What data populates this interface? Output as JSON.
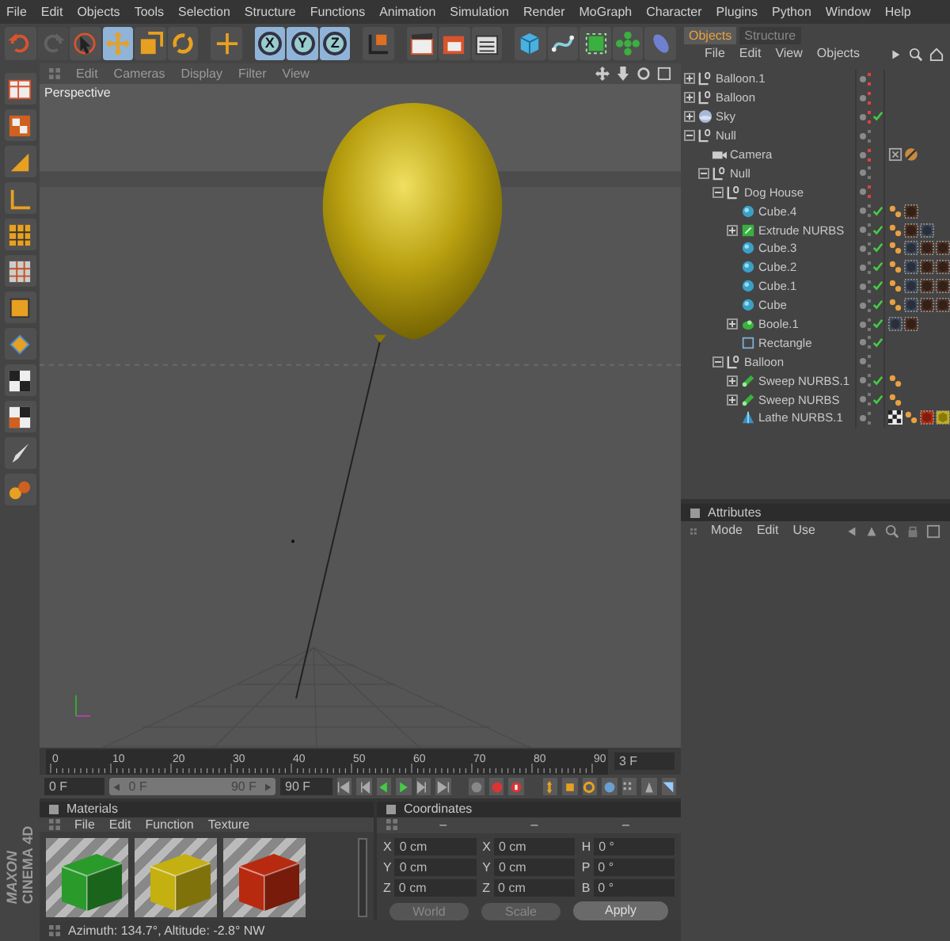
{
  "menu_bar": [
    "File",
    "Edit",
    "Objects",
    "Tools",
    "Selection",
    "Structure",
    "Functions",
    "Animation",
    "Simulation",
    "Render",
    "MoGraph",
    "Character",
    "Plugins",
    "Python",
    "Window",
    "Help"
  ],
  "toolbar": [
    {
      "kind": "undo",
      "selected": false,
      "disabled": false
    },
    {
      "kind": "redo",
      "selected": false,
      "disabled": true
    },
    {
      "kind": "select",
      "selected": false,
      "disabled": false
    },
    {
      "kind": "move",
      "selected": true,
      "disabled": false
    },
    {
      "kind": "scale",
      "selected": false,
      "disabled": false
    },
    {
      "kind": "rotate",
      "selected": false,
      "disabled": false
    },
    {
      "kind": "add",
      "selected": false,
      "disabled": false
    },
    {
      "kind": "axis",
      "label": "X",
      "selected": true,
      "disabled": false
    },
    {
      "kind": "axis",
      "label": "Y",
      "selected": true,
      "disabled": false
    },
    {
      "kind": "axis",
      "label": "Z",
      "selected": true,
      "disabled": false
    },
    {
      "kind": "world",
      "selected": false,
      "disabled": false
    },
    {
      "kind": "render_view",
      "selected": false,
      "disabled": false
    },
    {
      "kind": "render",
      "selected": false,
      "disabled": false
    },
    {
      "kind": "render_settings",
      "selected": false,
      "disabled": false
    },
    {
      "kind": "cube",
      "selected": false,
      "disabled": false
    },
    {
      "kind": "spline",
      "selected": false,
      "disabled": false
    },
    {
      "kind": "nurbs",
      "selected": false,
      "disabled": false
    },
    {
      "kind": "array",
      "selected": false,
      "disabled": false
    },
    {
      "kind": "deformer",
      "selected": false,
      "disabled": false
    }
  ],
  "viewport": {
    "menu": [
      "Edit",
      "Cameras",
      "Display",
      "Filter",
      "View"
    ],
    "label": "Perspective"
  },
  "timeline": {
    "ticks": [
      "0",
      "10",
      "20",
      "30",
      "40",
      "50",
      "60",
      "70",
      "80",
      "90"
    ],
    "current_frame": "3 F",
    "start_frame": "0 F",
    "range_start": "0 F",
    "range_end": "90 F",
    "end_frame": "90 F"
  },
  "materials": {
    "title": "Materials",
    "menu": [
      "File",
      "Edit",
      "Function",
      "Texture"
    ],
    "items": [
      {
        "color": "#2a9a2a"
      },
      {
        "color": "#c4b010"
      },
      {
        "color": "#b82a10"
      }
    ]
  },
  "coordinates": {
    "title": "Coordinates",
    "headers": [
      "–",
      "–",
      "–"
    ],
    "rows": [
      [
        {
          "axis": "X",
          "value": "0 cm"
        },
        {
          "axis": "X",
          "value": "0 cm"
        },
        {
          "axis": "H",
          "value": "0 °"
        }
      ],
      [
        {
          "axis": "Y",
          "value": "0 cm"
        },
        {
          "axis": "Y",
          "value": "0 cm"
        },
        {
          "axis": "P",
          "value": "0 °"
        }
      ],
      [
        {
          "axis": "Z",
          "value": "0 cm"
        },
        {
          "axis": "Z",
          "value": "0 cm"
        },
        {
          "axis": "B",
          "value": "0 °"
        }
      ]
    ],
    "mode": "World",
    "size_mode": "Scale",
    "apply": "Apply"
  },
  "status_bar": "Azimuth: 134.7°, Altitude: -2.8°  NW",
  "logo": {
    "brand": "MAXON",
    "product": "CINEMA 4D"
  },
  "object_manager": {
    "tabs": [
      {
        "label": "Objects",
        "selected": true
      },
      {
        "label": "Structure",
        "selected": false
      }
    ],
    "menu": [
      "File",
      "Edit",
      "View",
      "Objects"
    ],
    "tree": [
      {
        "name": "Balloon.1",
        "kind": "null",
        "expanded": false,
        "hidden": true
      },
      {
        "name": "Balloon",
        "kind": "null",
        "expanded": false,
        "hidden": true
      },
      {
        "name": "Sky",
        "kind": "sky",
        "expanded": false,
        "hidden": true,
        "checked": true
      },
      {
        "name": "Null",
        "kind": "null",
        "expanded": true,
        "hidden": false,
        "children": [
          {
            "name": "Camera",
            "kind": "camera",
            "hidden": true,
            "checked": false,
            "tags": [
              {
                "kind": "display"
              },
              {
                "kind": "protection"
              }
            ]
          },
          {
            "name": "Null",
            "kind": "null",
            "expanded": true,
            "hidden": false,
            "children": [
              {
                "name": "Dog House",
                "kind": "null",
                "expanded": true,
                "hidden": true,
                "children": [
                  {
                    "name": "Cube.4",
                    "kind": "primitive",
                    "hidden": false,
                    "checked": true,
                    "tags": [
                      {
                        "kind": "phong"
                      },
                      {
                        "kind": "texture",
                        "color": "#4a2e20"
                      }
                    ]
                  },
                  {
                    "name": "Extrude NURBS",
                    "kind": "extrude",
                    "expanded": false,
                    "hidden": false,
                    "checked": true,
                    "tags": [
                      {
                        "kind": "phong"
                      },
                      {
                        "kind": "texture",
                        "color": "#4a2e20"
                      },
                      {
                        "kind": "texture",
                        "color": "#3c4656"
                      }
                    ]
                  },
                  {
                    "name": "Cube.3",
                    "kind": "primitive",
                    "hidden": false,
                    "checked": true,
                    "tags": [
                      {
                        "kind": "phong"
                      },
                      {
                        "kind": "texture",
                        "color": "#3c4656"
                      },
                      {
                        "kind": "texture",
                        "color": "#4a2e20"
                      },
                      {
                        "kind": "texture",
                        "color": "#4a2e20"
                      }
                    ]
                  },
                  {
                    "name": "Cube.2",
                    "kind": "primitive",
                    "hidden": false,
                    "checked": true,
                    "tags": [
                      {
                        "kind": "phong"
                      },
                      {
                        "kind": "texture",
                        "color": "#3c4656"
                      },
                      {
                        "kind": "texture",
                        "color": "#4a2e20"
                      },
                      {
                        "kind": "texture",
                        "color": "#4a2e20"
                      }
                    ]
                  },
                  {
                    "name": "Cube.1",
                    "kind": "primitive",
                    "hidden": false,
                    "checked": true,
                    "tags": [
                      {
                        "kind": "phong"
                      },
                      {
                        "kind": "texture",
                        "color": "#3c4656"
                      },
                      {
                        "kind": "texture",
                        "color": "#4a2e20"
                      },
                      {
                        "kind": "texture",
                        "color": "#4a2e20"
                      }
                    ]
                  },
                  {
                    "name": "Cube",
                    "kind": "primitive",
                    "hidden": false,
                    "checked": true,
                    "tags": [
                      {
                        "kind": "phong"
                      },
                      {
                        "kind": "texture",
                        "color": "#3c4656"
                      },
                      {
                        "kind": "texture",
                        "color": "#4a2e20"
                      },
                      {
                        "kind": "texture",
                        "color": "#4a2e20"
                      }
                    ]
                  },
                  {
                    "name": "Boole.1",
                    "kind": "boole",
                    "expanded": false,
                    "hidden": false,
                    "checked": true,
                    "tags": [
                      {
                        "kind": "texture",
                        "color": "#3c4656"
                      },
                      {
                        "kind": "texture",
                        "color": "#4a2e20"
                      }
                    ]
                  },
                  {
                    "name": "Rectangle",
                    "kind": "spline",
                    "hidden": false,
                    "checked": true
                  }
                ]
              },
              {
                "name": "Balloon",
                "kind": "null",
                "expanded": true,
                "hidden": false,
                "children": [
                  {
                    "name": "Sweep NURBS.1",
                    "kind": "sweep",
                    "expanded": false,
                    "hidden": false,
                    "checked": true,
                    "tags": [
                      {
                        "kind": "phong"
                      }
                    ]
                  },
                  {
                    "name": "Sweep NURBS",
                    "kind": "sweep",
                    "expanded": false,
                    "hidden": false,
                    "checked": true,
                    "tags": [
                      {
                        "kind": "phong"
                      }
                    ]
                  },
                  {
                    "name": "Lathe NURBS.1",
                    "kind": "lathe",
                    "hidden": false,
                    "checked": false,
                    "tags": [
                      {
                        "kind": "checker"
                      },
                      {
                        "kind": "phong"
                      },
                      {
                        "kind": "texture",
                        "color": "#b82a10"
                      },
                      {
                        "kind": "texture",
                        "color": "#c4b010"
                      }
                    ]
                  }
                ]
              }
            ]
          }
        ]
      }
    ]
  },
  "attributes": {
    "title": "Attributes",
    "menu": [
      "Mode",
      "Edit",
      "Use"
    ]
  }
}
